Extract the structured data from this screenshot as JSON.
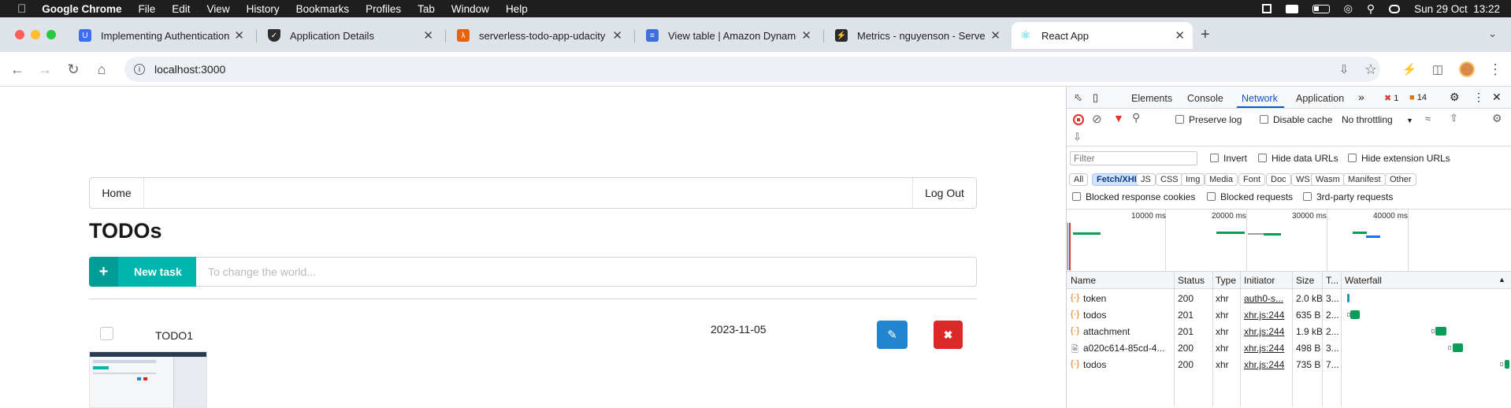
{
  "menubar": {
    "app_name": "Google Chrome",
    "items": [
      "File",
      "Edit",
      "View",
      "History",
      "Bookmarks",
      "Profiles",
      "Tab",
      "Window",
      "Help"
    ],
    "clock": "Sun 29 Oct  13:22"
  },
  "tabs": [
    {
      "label": "Implementing Authentication",
      "icon": "udacity-icon",
      "color": "#3b6ef5"
    },
    {
      "label": "Application Details",
      "icon": "shield-icon",
      "color": "#2e2e2e"
    },
    {
      "label": "serverless-todo-app-udacity",
      "icon": "aws-icon",
      "color": "#e8640c"
    },
    {
      "label": "View table | Amazon DynamoDB",
      "icon": "dynamodb-icon",
      "color": "#3f6fd8"
    },
    {
      "label": "Metrics - nguyenson - Serverless",
      "icon": "serverless-icon",
      "color": "#2b2b2b"
    },
    {
      "label": "React App",
      "icon": "react-icon",
      "color": "#25c2e0"
    }
  ],
  "omnibox": {
    "url": "localhost:3000"
  },
  "app": {
    "home": "Home",
    "logout": "Log Out",
    "title": "TODOs",
    "new_task": "New task",
    "input_placeholder": "To change the world...",
    "todos": [
      {
        "name": "TODO1",
        "due": "2023-11-05",
        "done": false
      }
    ]
  },
  "devtools": {
    "tabs": [
      "Elements",
      "Console",
      "Network",
      "Application"
    ],
    "active_tab": "Network",
    "errors": "1",
    "warnings": "14",
    "preserve_log": "Preserve log",
    "disable_cache": "Disable cache",
    "throttling": "No throttling",
    "filter_placeholder": "Filter",
    "invert": "Invert",
    "hide_data_urls": "Hide data URLs",
    "hide_ext_urls": "Hide extension URLs",
    "type_filters": [
      "All",
      "Fetch/XHR",
      "JS",
      "CSS",
      "Img",
      "Media",
      "Font",
      "Doc",
      "WS",
      "Wasm",
      "Manifest",
      "Other"
    ],
    "selected_filter": "Fetch/XHR",
    "blocked_cookies": "Blocked response cookies",
    "blocked_requests": "Blocked requests",
    "third_party": "3rd-party requests",
    "timeline_ticks": [
      "10000 ms",
      "20000 ms",
      "30000 ms",
      "40000 ms"
    ],
    "columns": [
      "Name",
      "Status",
      "Type",
      "Initiator",
      "Size",
      "T...",
      "Waterfall"
    ],
    "requests": [
      {
        "name": "token",
        "status": "200",
        "type": "xhr",
        "initiator": "auth0-s...",
        "size": "2.0 kB",
        "time": "3..."
      },
      {
        "name": "todos",
        "status": "201",
        "type": "xhr",
        "initiator": "xhr.js:244",
        "size": "635 B",
        "time": "2..."
      },
      {
        "name": "attachment",
        "status": "201",
        "type": "xhr",
        "initiator": "xhr.js:244",
        "size": "1.9 kB",
        "time": "2..."
      },
      {
        "name": "a020c614-85cd-4...",
        "status": "200",
        "type": "xhr",
        "initiator": "xhr.js:244",
        "size": "498 B",
        "time": "3..."
      },
      {
        "name": "todos",
        "status": "200",
        "type": "xhr",
        "initiator": "xhr.js:244",
        "size": "735 B",
        "time": "7..."
      }
    ]
  }
}
